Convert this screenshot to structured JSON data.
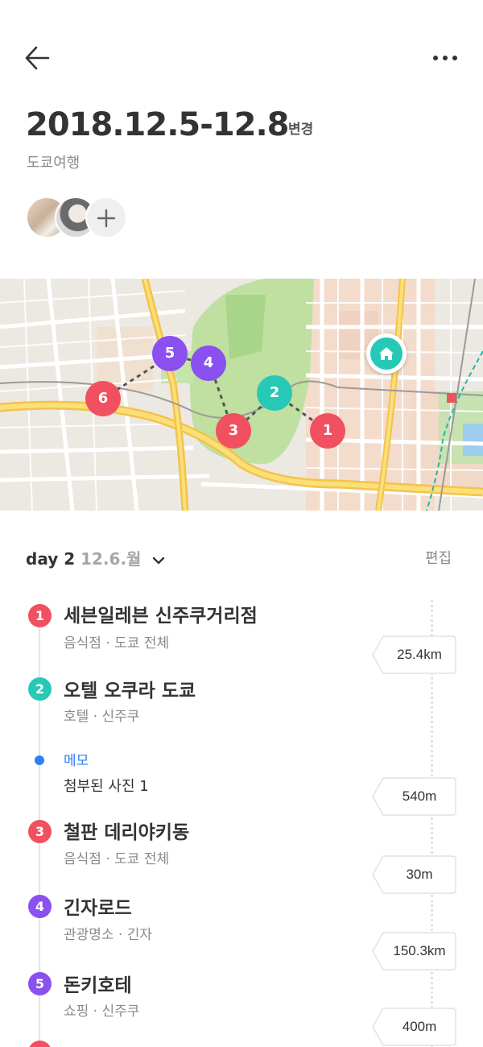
{
  "header": {
    "back_icon": "arrow-left-icon",
    "more_icon": "more-horizontal-icon",
    "date_range": "2018.12.5-12.8",
    "change_label": "변경",
    "trip_name": "도쿄여행",
    "add_icon": "plus-icon"
  },
  "map": {
    "home_icon": "home-icon",
    "markers": [
      "1",
      "2",
      "3",
      "4",
      "5",
      "6"
    ],
    "colors": {
      "red": "#f0505f",
      "teal": "#25c9b6",
      "purple": "#8a50f0"
    }
  },
  "day": {
    "label": "day 2",
    "date": "12.6.월",
    "toggle_icon": "chevron-down-icon",
    "edit_label": "편집"
  },
  "stops": [
    {
      "num": "1",
      "name": "세븐일레븐 신주쿠거리점",
      "sub": "음식점 · 도쿄 전체",
      "color": "#f0505f"
    },
    {
      "num": "2",
      "name": "오텔 오쿠라 도쿄",
      "sub": "호텔 · 신주쿠",
      "color": "#25c9b6"
    },
    {
      "num": "3",
      "name": "철판 데리야키동",
      "sub": "음식점 · 도쿄 전체",
      "color": "#f0505f"
    },
    {
      "num": "4",
      "name": "긴자로드",
      "sub": "관광명소 · 긴자",
      "color": "#8a50f0"
    },
    {
      "num": "5",
      "name": "돈키호테",
      "sub": "쇼핑 · 신주쿠",
      "color": "#8a50f0"
    }
  ],
  "memo": {
    "label": "메모",
    "text": "첨부된 사진 1",
    "color": "#2f7ff5"
  },
  "distances": [
    "25.4km",
    "540m",
    "30m",
    "150.3km",
    "400m"
  ]
}
